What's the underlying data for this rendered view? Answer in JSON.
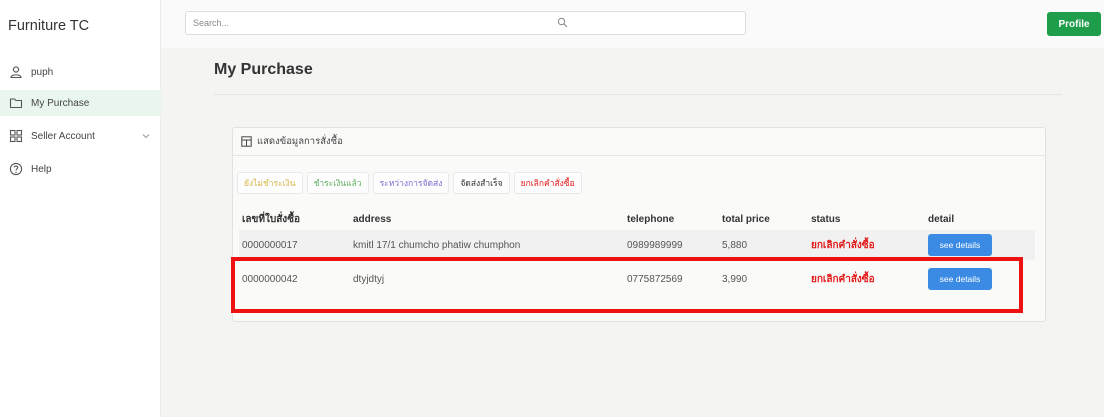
{
  "app": {
    "title": "Furniture TC"
  },
  "sidebar": {
    "items": [
      {
        "label": "puph",
        "icon": "user-icon"
      },
      {
        "label": "My Purchase",
        "icon": "folder-icon",
        "active": true
      },
      {
        "label": "Seller Account",
        "icon": "grid-icon",
        "expandable": true
      },
      {
        "label": "Help",
        "icon": "help-icon"
      }
    ]
  },
  "header": {
    "search_placeholder": "Search...",
    "profile_label": "Profile"
  },
  "main": {
    "title": "My Purchase",
    "card_title": "แสดงข้อมูลการสั่งซื้อ",
    "tabs": [
      {
        "label": "ยังไม่ชำระเงิน",
        "color": "#d9b84a"
      },
      {
        "label": "ชำระเงินแล้ว",
        "color": "#5fae5f"
      },
      {
        "label": "ระหว่างการจัดส่ง",
        "color": "#7a6bd1"
      },
      {
        "label": "จัดส่งสำเร็จ",
        "color": "#333333"
      },
      {
        "label": "ยกเลิกคำสั่งซื้อ",
        "color": "#e31b1b"
      }
    ],
    "table": {
      "columns": [
        "เลขที่ใบสั่งซื้อ",
        "address",
        "telephone",
        "total price",
        "status",
        "detail"
      ],
      "rows": [
        {
          "order_no": "0000000017",
          "address": "kmitl 17/1 chumcho phatiw chumphon",
          "telephone": "0989989999",
          "total_price": "5,880",
          "status": "ยกเลิกคำสั่งซื้อ",
          "detail": "see details"
        },
        {
          "order_no": "0000000042",
          "address": "dtyjdtyj",
          "telephone": "0775872569",
          "total_price": "3,990",
          "status": "ยกเลิกคำสั่งซื้อ",
          "detail": "see details"
        }
      ]
    }
  },
  "colors": {
    "accent": "#1e9e4a",
    "cancel": "#e31b1b",
    "detail_button": "#3b8be5",
    "highlight": "#ee1111"
  }
}
